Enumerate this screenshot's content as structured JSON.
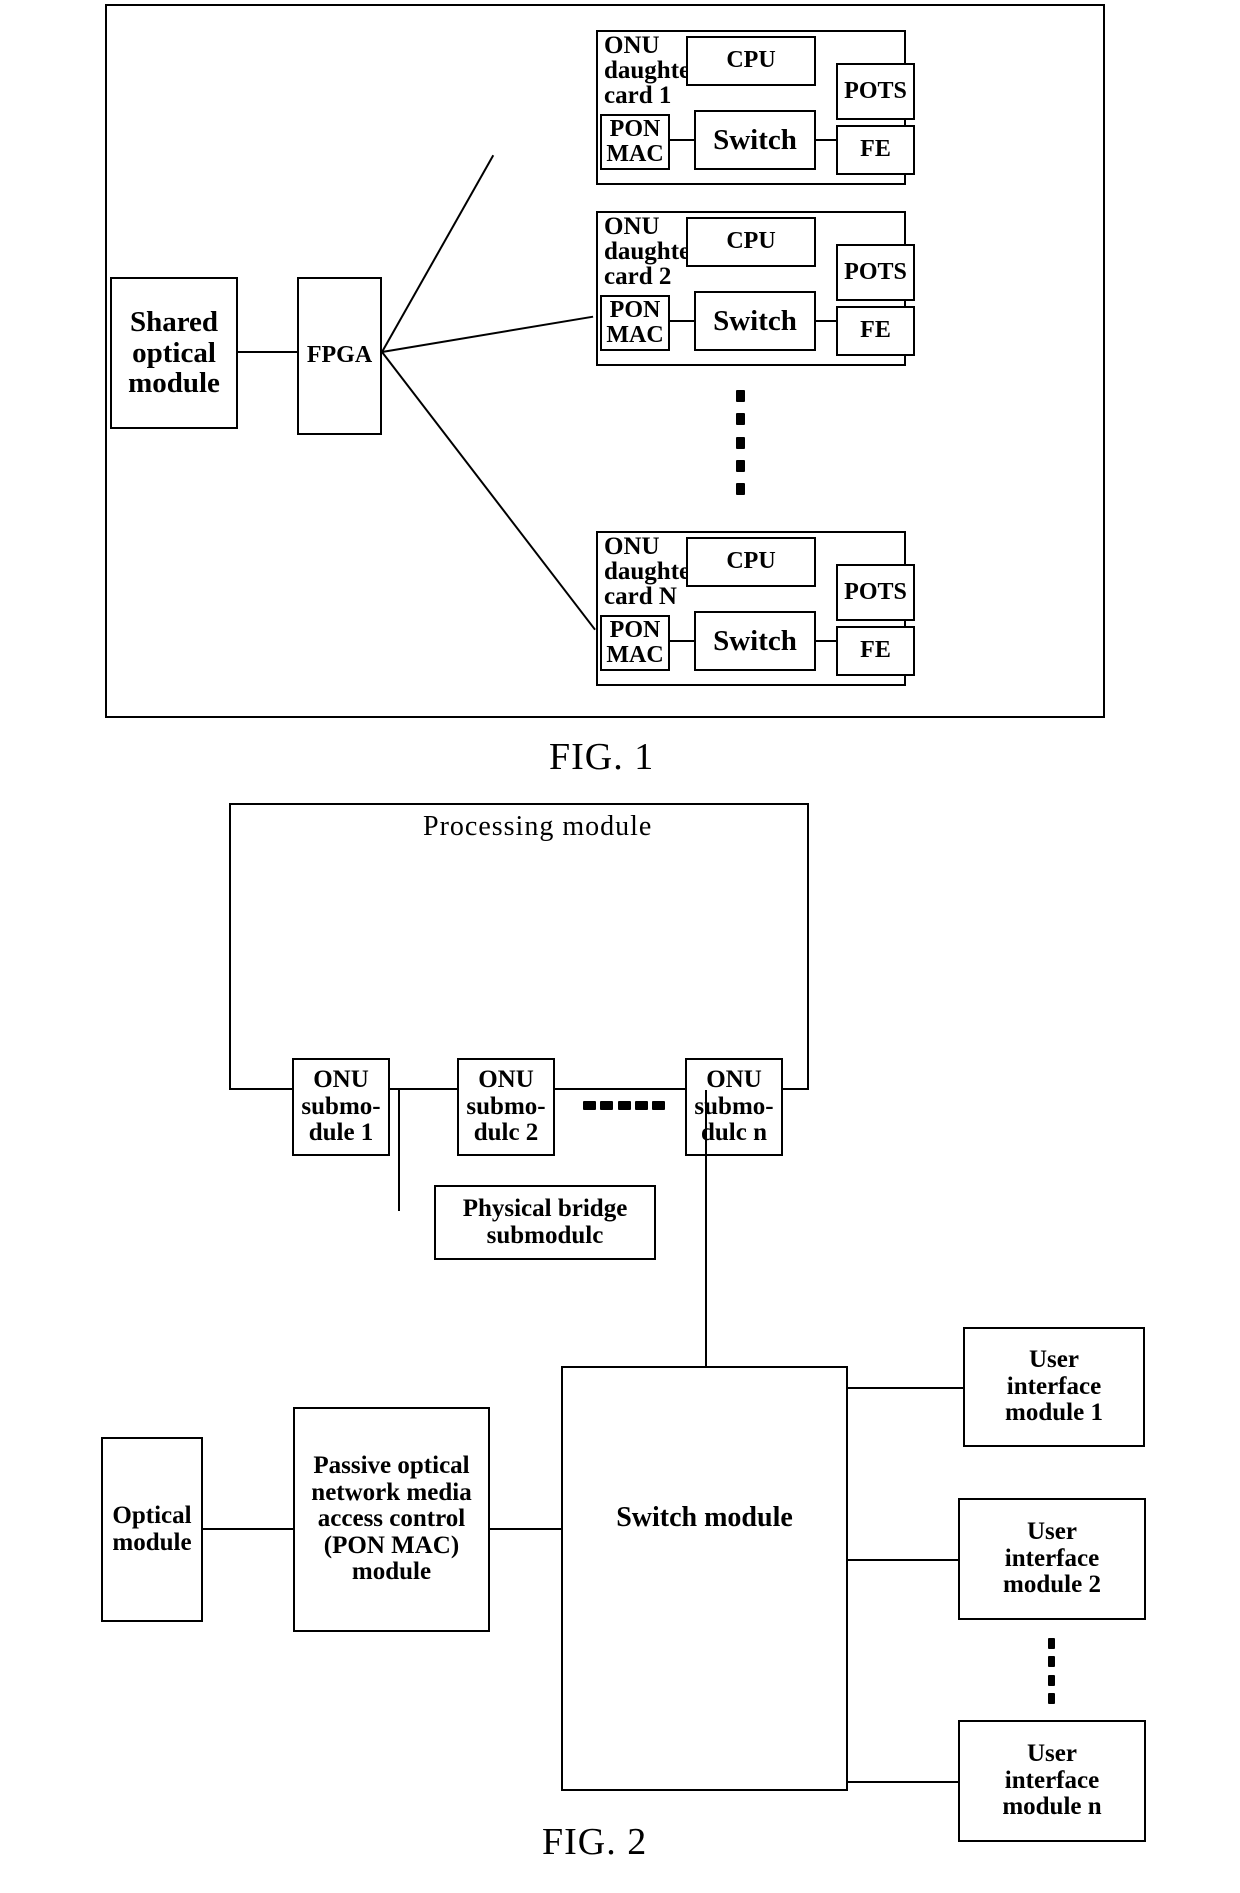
{
  "document": {
    "type": "patent-drawing-sheet",
    "figures": [
      {
        "id": "fig1",
        "caption": "FIG. 1",
        "blocks": {
          "shared_optical_module": "Shared\noptical\nmodule",
          "fpga": "FPGA"
        },
        "cards": [
          {
            "title": "ONU\ndaughter\ncard 1",
            "pon_mac": "PON\nMAC",
            "cpu": "CPU",
            "switch": "Switch",
            "pots": "POTS",
            "fe": "FE"
          },
          {
            "title": "ONU\ndaughter\ncard 2",
            "pon_mac": "PON\nMAC",
            "cpu": "CPU",
            "switch": "Switch",
            "pots": "POTS",
            "fe": "FE"
          },
          {
            "title": "ONU\ndaughter\ncard N",
            "pon_mac": "PON\nMAC",
            "cpu": "CPU",
            "switch": "Switch",
            "pots": "POTS",
            "fe": "FE"
          }
        ],
        "ellipsis": "vertical-dots-between-card-2-and-card-N"
      },
      {
        "id": "fig2",
        "caption": "FIG. 2",
        "processing_module": {
          "title": "Processing module",
          "onu_submodules": [
            "ONU\nsubmo-\ndule 1",
            "ONU\nsubmo-\ndulc 2",
            "ONU\nsubmo-\ndulc n"
          ],
          "ellipsis": "------",
          "physical_bridge": "Physical bridge\nsubmodulc"
        },
        "optical_module": "Optical\nmodule",
        "pon_mac_module": "Passive optical\nnetwork media\naccess control\n(PON MAC)\nmodule",
        "switch_module": "Switch module",
        "user_interface_modules": [
          "User\ninterface\nmodule 1",
          "User\ninterface\nmodule 2",
          "User\ninterface\nmodule n"
        ],
        "ui_ellipsis": "vertical-dots-between-ui-2-and-ui-n"
      }
    ]
  },
  "colors": {
    "ink": "#000000",
    "paper": "#ffffff"
  }
}
